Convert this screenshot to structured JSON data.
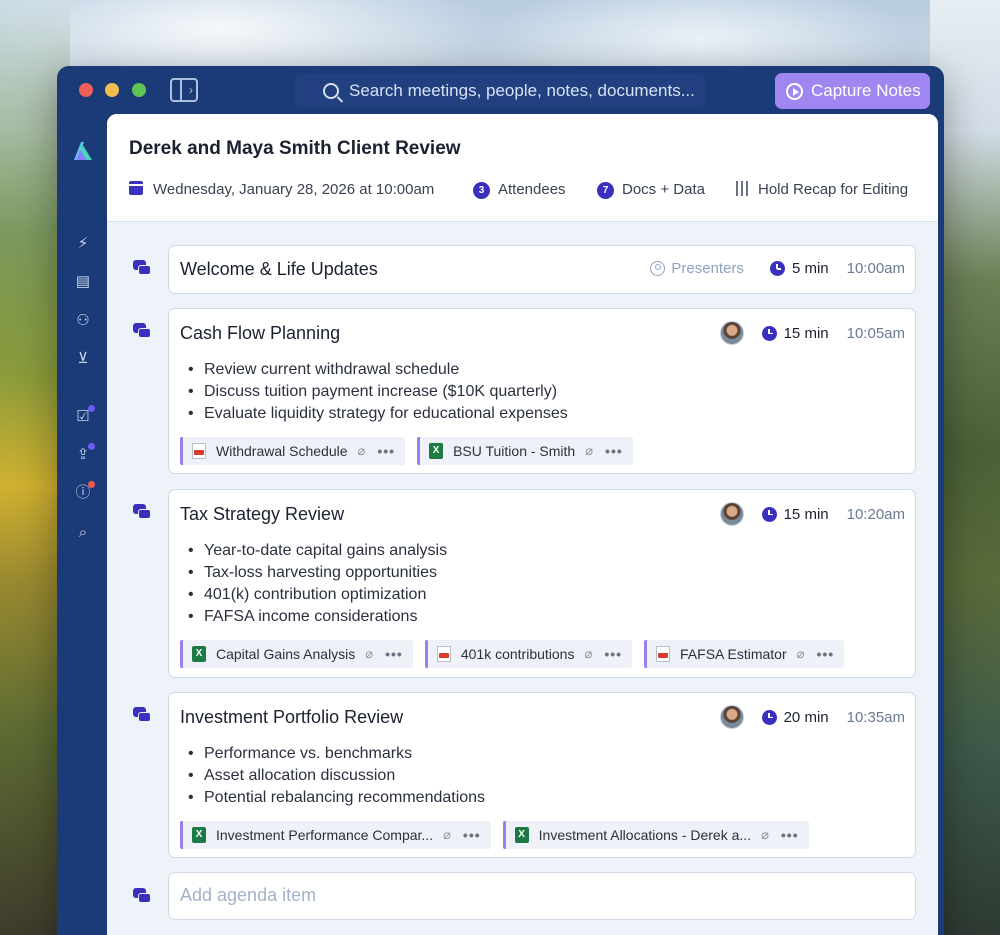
{
  "titlebar": {
    "search_placeholder": "Search meetings, people, notes, documents...",
    "capture_label": "Capture Notes"
  },
  "header": {
    "title": "Derek and Maya Smith Client Review",
    "date": "Wednesday, January 28, 2026 at 10:00am",
    "attendees_count": "3",
    "attendees_label": "Attendees",
    "docs_count": "7",
    "docs_label": "Docs + Data",
    "hold_label": "Hold Recap for Editing"
  },
  "agenda": [
    {
      "title": "Welcome & Life Updates",
      "presenters": "Presenters",
      "duration": "5 min",
      "start": "10:00am",
      "bullets": [],
      "files": []
    },
    {
      "title": "Cash Flow Planning",
      "duration": "15 min",
      "start": "10:05am",
      "bullets": [
        "Review current withdrawal schedule",
        "Discuss tuition payment increase ($10K quarterly)",
        "Evaluate liquidity strategy for educational expenses"
      ],
      "files": [
        {
          "name": "Withdrawal Schedule",
          "type": "pdf"
        },
        {
          "name": "BSU Tuition - Smith",
          "type": "xls"
        }
      ]
    },
    {
      "title": "Tax Strategy Review",
      "duration": "15 min",
      "start": "10:20am",
      "bullets": [
        "Year-to-date capital gains analysis",
        "Tax-loss harvesting opportunities",
        "401(k) contribution optimization",
        "FAFSA income considerations"
      ],
      "files": [
        {
          "name": "Capital Gains Analysis",
          "type": "xls"
        },
        {
          "name": "401k contributions",
          "type": "pdf"
        },
        {
          "name": "FAFSA Estimator",
          "type": "pdf"
        }
      ]
    },
    {
      "title": "Investment Portfolio Review",
      "duration": "20 min",
      "start": "10:35am",
      "bullets": [
        "Performance vs. benchmarks",
        "Asset allocation discussion",
        "Potential rebalancing recommendations"
      ],
      "files": [
        {
          "name": "Investment Performance Compar...",
          "type": "xls"
        },
        {
          "name": "Investment Allocations - Derek a...",
          "type": "xls"
        }
      ]
    }
  ],
  "add_item_placeholder": "Add agenda item",
  "colors": {
    "window": "#1b3a78",
    "accent": "#3b2fbf",
    "capture_button": "#9f86f0",
    "chip_border": "#9b7fee"
  }
}
